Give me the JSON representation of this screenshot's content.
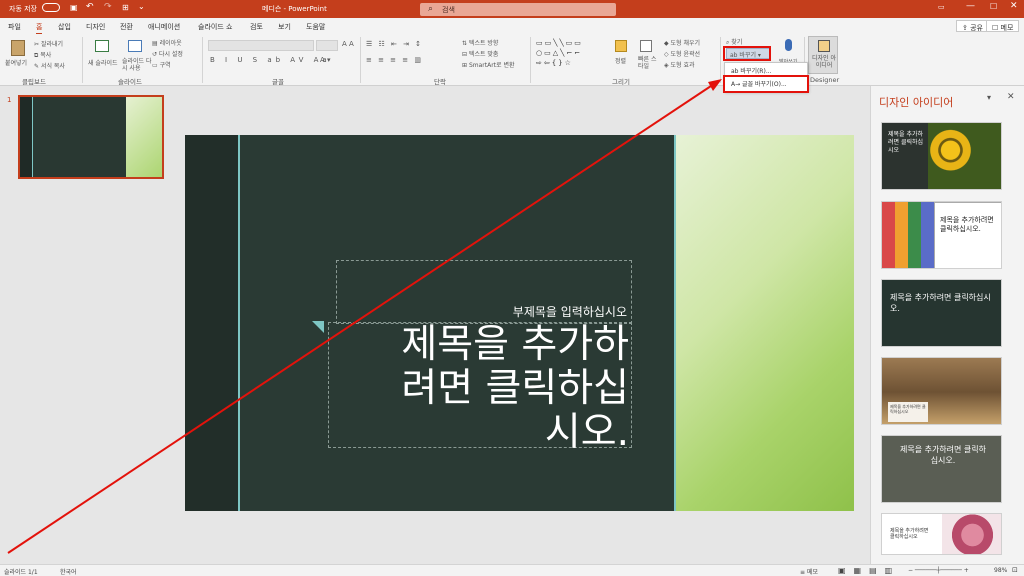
{
  "titlebar": {
    "autosave": "자동 저장",
    "doc_title": "메디슨 - PowerPoint",
    "search_placeholder": "검색",
    "colors": {
      "bar": "#c43e1c"
    }
  },
  "tabs": [
    "파일",
    "홈",
    "삽입",
    "디자인",
    "전환",
    "애니메이션",
    "슬라이드 쇼",
    "검토",
    "보기",
    "도움말"
  ],
  "tab_active_index": 1,
  "share_label": "공유",
  "comment_label": "메모",
  "ribbon": {
    "clipboard": {
      "paste": "붙여넣기",
      "cut": "잘라내기",
      "copy": "복사",
      "format": "서식 복사",
      "label": "클립보드"
    },
    "slides": {
      "new": "새 슬라이드",
      "reuse": "슬라이드 다시 사용",
      "layout": "레이아웃",
      "reset": "다시 설정",
      "section": "구역",
      "label": "슬라이드"
    },
    "font": {
      "label": "글꼴"
    },
    "paragraph": {
      "text_dir": "텍스트 방향",
      "align_text": "텍스트 맞춤",
      "smartart": "SmartArt로 변환",
      "label": "단락"
    },
    "drawing": {
      "arrange": "정렬",
      "quick_styles": "빠른 스타일",
      "fill": "도형 채우기",
      "outline": "도형 윤곽선",
      "effects": "도형 효과",
      "label": "그리기"
    },
    "editing": {
      "find": "찾기",
      "replace": "바꾸기",
      "replace_item": "바꾸기(R)...",
      "replace_font": "글꼴 바꾸기(O)..."
    },
    "voice": {
      "dictate": "받아쓰기"
    },
    "designer": {
      "btn": "디자인 아이디어",
      "label": "Designer"
    }
  },
  "thumbnail": {
    "number": "1"
  },
  "slide": {
    "subtitle": "부제목을 입력하십시오",
    "title_line1": "제목을 추가하",
    "title_line2": "려면 클릭하십",
    "title_line3": "시오."
  },
  "design_pane": {
    "title": "디자인 아이디어",
    "cards": [
      {
        "text": "제목을 추가하려면 클릭하십시오"
      },
      {
        "text": "제목을 추가하려면 클릭하십시오."
      },
      {
        "text": "제목을 추가하려면 클릭하십시오."
      },
      {
        "text": "제목을 추가하려면 클릭하십시오"
      },
      {
        "text": "제목을 추가하려면 클릭하십시오."
      },
      {
        "text": "제목을 추가하려면 클릭하십시오"
      }
    ]
  },
  "statusbar": {
    "slide": "슬라이드 1/1",
    "lang": "한국어",
    "notes": "메모",
    "zoom": "98%"
  }
}
